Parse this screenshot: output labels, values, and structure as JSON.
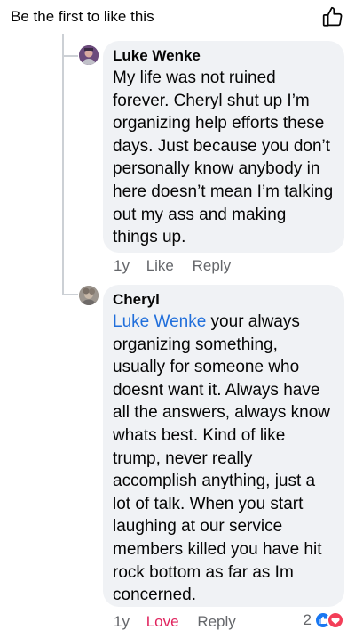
{
  "header": {
    "title": "Be the first to like this"
  },
  "comments": [
    {
      "author": "Luke Wenke",
      "text": "My life was not ruined forever.  Cheryl shut up I’m organizing help efforts these days.  Just because you don’t personally know anybody in here doesn’t mean I’m talking out my ass and making things up.",
      "time": "1y",
      "like_label": "Like",
      "reply_label": "Reply"
    },
    {
      "author": "Cheryl",
      "mention": "Luke Wenke",
      "text": " your always organizing something, usually for someone who doesnt want it.  Always have all the answers, always know whats best. Kind of like trump, never really accomplish anything, just a lot of talk. When you start laughing at our service members killed you have hit rock bottom as far as Im concerned.",
      "time": "1y",
      "like_label": "Love",
      "reply_label": "Reply",
      "reaction_count": "2",
      "colors": {
        "love": "#e0245e",
        "mention": "#216fdb"
      }
    }
  ]
}
